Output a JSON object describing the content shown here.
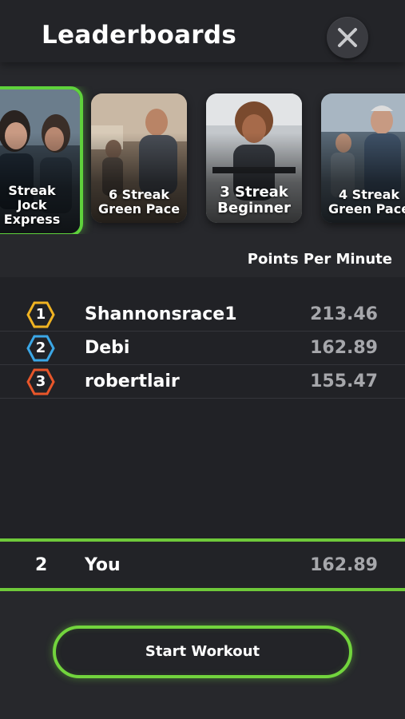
{
  "header": {
    "title": "Leaderboards"
  },
  "workouts": [
    {
      "label": "Streak\nJock\nExpress",
      "selected": true
    },
    {
      "label": "6 Streak\nGreen Pace",
      "selected": false
    },
    {
      "label": "3 Streak\nBeginner",
      "selected": false
    },
    {
      "label": "4 Streak\nGreen Pace",
      "selected": false
    }
  ],
  "metric": "Points Per Minute",
  "leaders": [
    {
      "rank": "1",
      "name": "Shannonsrace1",
      "score": "213.46",
      "badge_color": "#f0b322"
    },
    {
      "rank": "2",
      "name": "Debi",
      "score": "162.89",
      "badge_color": "#3ba7e6"
    },
    {
      "rank": "3",
      "name": "robertlair",
      "score": "155.47",
      "badge_color": "#e8562a"
    }
  ],
  "you": {
    "rank": "2",
    "name": "You",
    "score": "162.89"
  },
  "cta": {
    "label": "Start Workout"
  },
  "colors": {
    "accent": "#6fc93a",
    "background": "#27282c"
  }
}
